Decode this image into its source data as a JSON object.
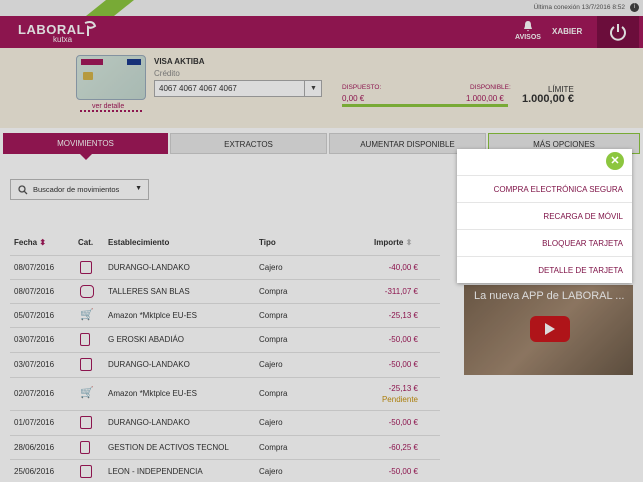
{
  "topbar": {
    "last_connection": "Última conexión  13/7/2016 8:52",
    "info_icon": "i"
  },
  "header": {
    "logo_main": "LABORAL",
    "logo_sub": "kutxa",
    "avisos": "AVISOS",
    "user": "XABIER"
  },
  "card": {
    "name": "VISA AKTIBA",
    "type": "Crédito",
    "number": "4067 4067 4067 4067",
    "ver_detalle": "ver detalle",
    "dispuesto_label": "DISPUESTO:",
    "dispuesto": "0,00 €",
    "disponible_label": "DISPONIBLE:",
    "disponible": "1.000,00 €",
    "limite_label": "LÍMITE",
    "limite": "1.000,00 €",
    "available_fraction": 1.0
  },
  "tabs": [
    "MOVIMIENTOS",
    "EXTRACTOS",
    "AUMENTAR DISPONIBLE",
    "MÁS OPCIONES"
  ],
  "search": {
    "label": "Buscador de movimientos"
  },
  "table": {
    "headers": {
      "fecha": "Fecha",
      "cat": "Cat.",
      "est": "Establecimiento",
      "tipo": "Tipo",
      "importe": "Importe"
    },
    "rows": [
      {
        "fecha": "08/07/2016",
        "est": "DURANGO-LANDAKO",
        "tipo": "Cajero",
        "importe": "-40,00 €",
        "status": "",
        "cat_icon": "atm-icon"
      },
      {
        "fecha": "08/07/2016",
        "est": "TALLERES SAN BLAS",
        "tipo": "Compra",
        "importe": "-311,07 €",
        "status": "",
        "cat_icon": "car-icon"
      },
      {
        "fecha": "05/07/2016",
        "est": "Amazon *Mktplce EU-ES",
        "tipo": "Compra",
        "importe": "-25,13 €",
        "status": "",
        "cat_icon": "cart-icon"
      },
      {
        "fecha": "03/07/2016",
        "est": "G EROSKI ABADIÁO",
        "tipo": "Compra",
        "importe": "-50,00 €",
        "status": "",
        "cat_icon": "fuel-icon"
      },
      {
        "fecha": "03/07/2016",
        "est": "DURANGO-LANDAKO",
        "tipo": "Cajero",
        "importe": "-50,00 €",
        "status": "",
        "cat_icon": "atm-icon"
      },
      {
        "fecha": "02/07/2016",
        "est": "Amazon *Mktplce EU-ES",
        "tipo": "Compra",
        "importe": "-25,13 €",
        "status": "Pendiente",
        "cat_icon": "cart-icon"
      },
      {
        "fecha": "01/07/2016",
        "est": "DURANGO-LANDAKO",
        "tipo": "Cajero",
        "importe": "-50,00 €",
        "status": "",
        "cat_icon": "atm-icon"
      },
      {
        "fecha": "28/06/2016",
        "est": "GESTION DE ACTIVOS TECNOL",
        "tipo": "Compra",
        "importe": "-60,25 €",
        "status": "",
        "cat_icon": "phone-icon"
      },
      {
        "fecha": "25/06/2016",
        "est": "LEON - INDEPENDENCIA",
        "tipo": "Cajero",
        "importe": "-50,00 €",
        "status": "",
        "cat_icon": "atm-icon"
      }
    ]
  },
  "video": {
    "title": "La nueva APP de LABORAL ..."
  },
  "popup": {
    "items": [
      "COMPRA ELECTRÓNICA SEGURA",
      "RECARGA DE MÓVIL",
      "BLOQUEAR TARJETA",
      "DETALLE DE TARJETA"
    ]
  },
  "colors": {
    "brand": "#a3195b",
    "accent": "#8cc63f"
  }
}
